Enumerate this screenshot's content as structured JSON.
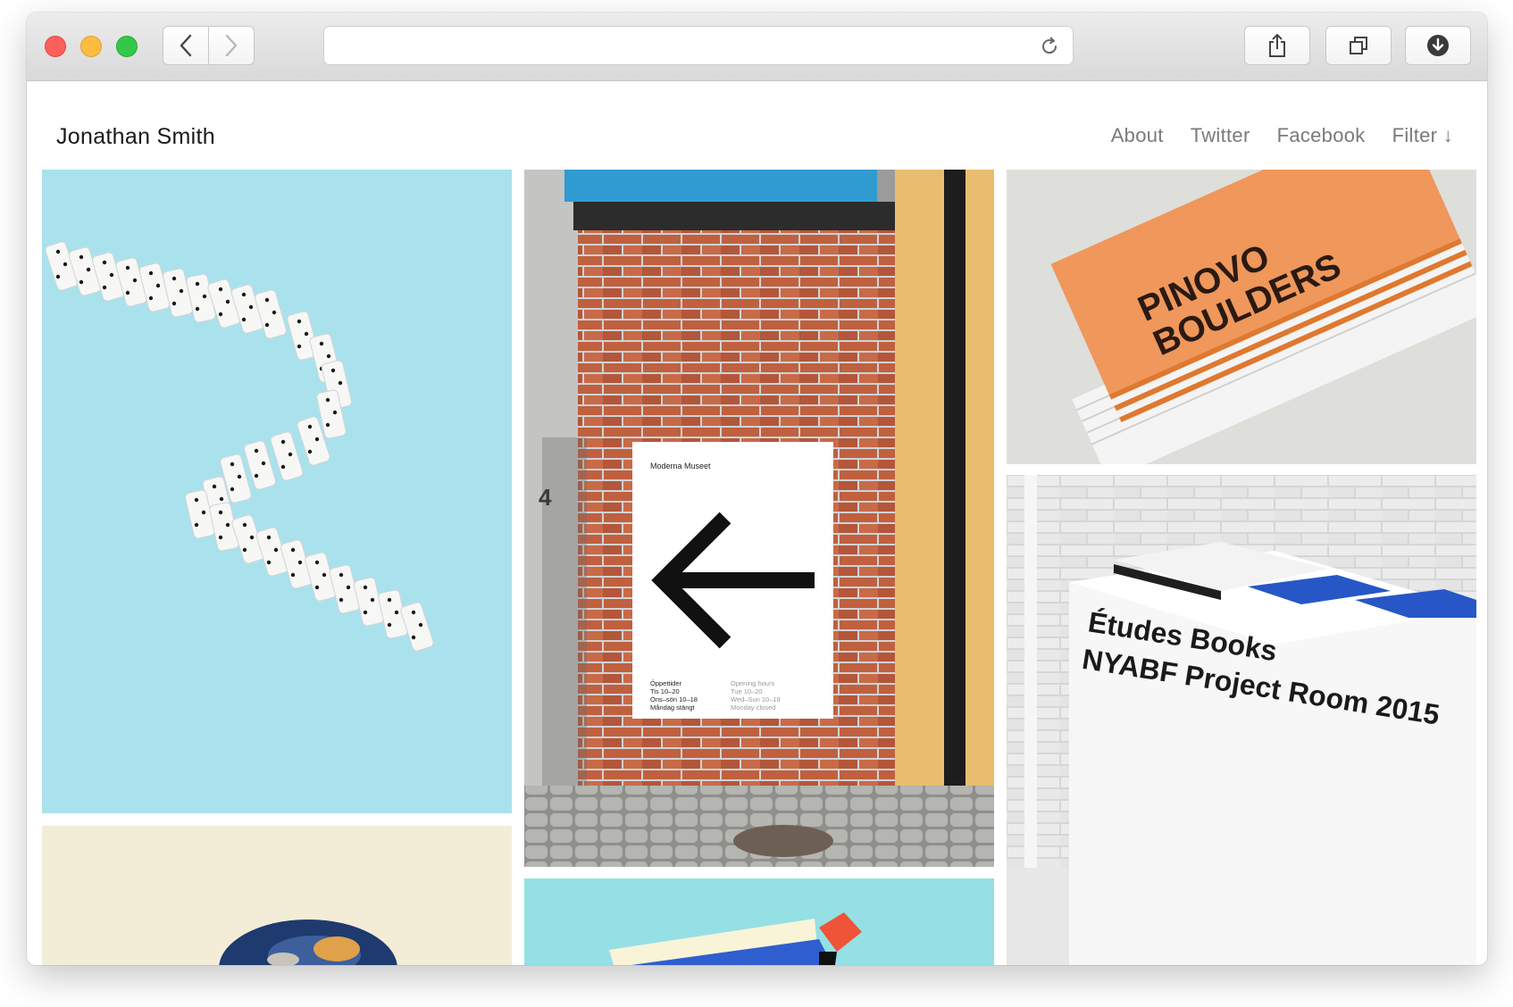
{
  "browser": {
    "url": "",
    "buttons": {
      "back_icon": "chevron-left-icon",
      "forward_icon": "chevron-right-icon",
      "reload_icon": "reload-icon",
      "share_icon": "share-icon",
      "tabs_icon": "tabs-icon",
      "download_icon": "download-icon"
    }
  },
  "site": {
    "title": "Jonathan Smith",
    "nav": {
      "about": "About",
      "twitter": "Twitter",
      "facebook": "Facebook",
      "filter": "Filter ↓"
    }
  },
  "gallery": {
    "poster": {
      "museum": "Moderna Museet",
      "door_number": "4",
      "hours_sv": [
        "Öppettider",
        "Tis        10–20",
        "Ons–sön  10–18",
        "Måndag stängt"
      ],
      "hours_en": [
        "Opening hours",
        "Tue        10–20",
        "Wed–Sun  10–18",
        "Monday closed"
      ]
    },
    "brochure": {
      "line1": "PINOVO",
      "line2": "BOULDERS"
    },
    "books": {
      "line1": "Études Books",
      "line2": "NYABF Project Room 2015"
    }
  },
  "colors": {
    "dominoes_bg": "#a9e2ed",
    "brochure_orange": "#f0975b",
    "paint_bg": "#f3ecd7",
    "shapes_bg": "#95e0e4",
    "nav_text": "#7a7a7a"
  }
}
